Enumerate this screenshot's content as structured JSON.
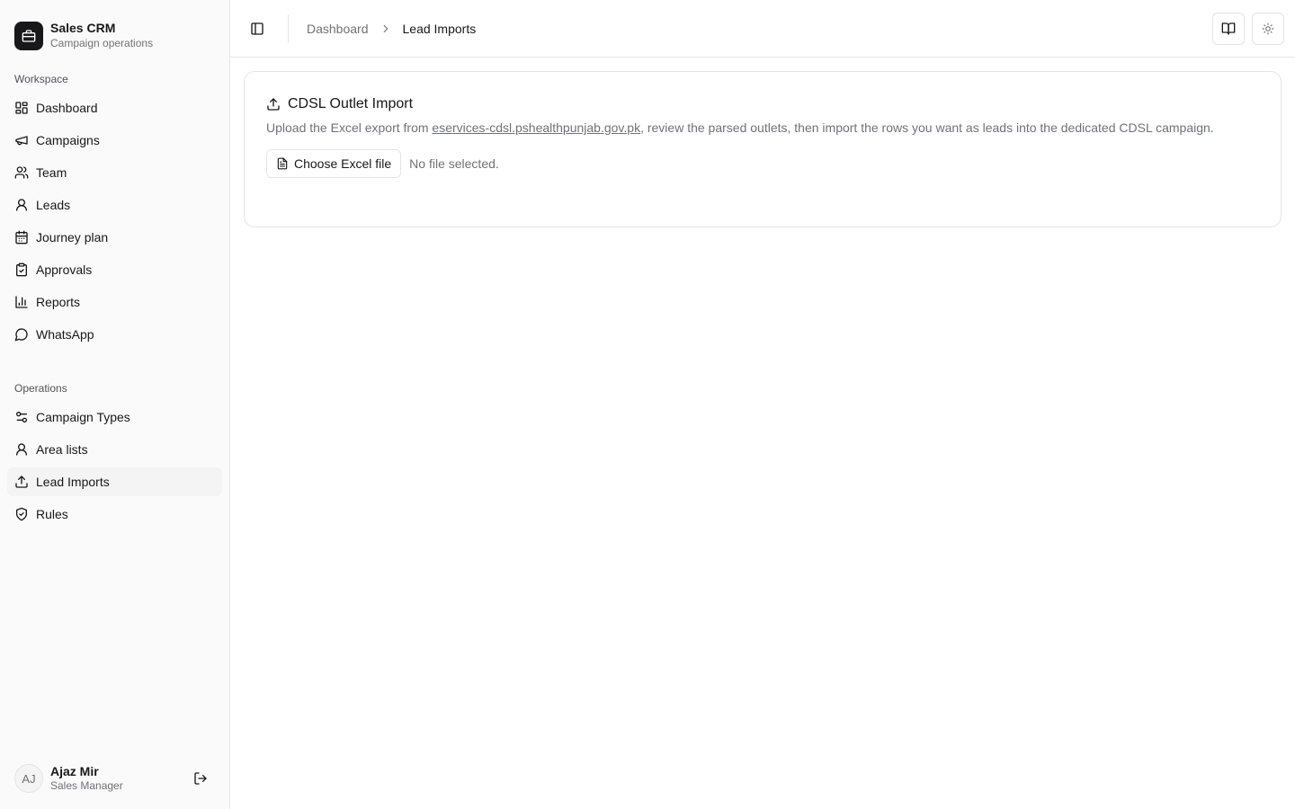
{
  "brand": {
    "name": "Sales CRM",
    "subtitle": "Campaign operations"
  },
  "sidebar": {
    "workspace_label": "Workspace",
    "workspace_items": [
      {
        "label": "Dashboard",
        "icon": "dashboard-icon"
      },
      {
        "label": "Campaigns",
        "icon": "megaphone-icon"
      },
      {
        "label": "Team",
        "icon": "users-icon"
      },
      {
        "label": "Leads",
        "icon": "user-icon"
      },
      {
        "label": "Journey plan",
        "icon": "calendar-icon"
      },
      {
        "label": "Approvals",
        "icon": "clipboard-check-icon"
      },
      {
        "label": "Reports",
        "icon": "bar-chart-icon"
      },
      {
        "label": "WhatsApp",
        "icon": "message-circle-icon"
      }
    ],
    "operations_label": "Operations",
    "operations_items": [
      {
        "label": "Campaign Types",
        "icon": "sliders-icon"
      },
      {
        "label": "Area lists",
        "icon": "user-pin-icon"
      },
      {
        "label": "Lead Imports",
        "icon": "upload-icon",
        "active": true
      },
      {
        "label": "Rules",
        "icon": "shield-check-icon"
      }
    ]
  },
  "user": {
    "initials": "AJ",
    "name": "Ajaz Mir",
    "role": "Sales Manager"
  },
  "breadcrumb": {
    "parent": "Dashboard",
    "current": "Lead Imports"
  },
  "card": {
    "title": "CDSL Outlet Import",
    "desc_before": "Upload the Excel export from ",
    "desc_link": "eservices-cdsl.pshealthpunjab.gov.pk",
    "desc_after": ", review the parsed outlets, then import the rows you want as leads into the dedicated CDSL campaign.",
    "file_button": "Choose Excel file",
    "file_status": "No file selected."
  }
}
